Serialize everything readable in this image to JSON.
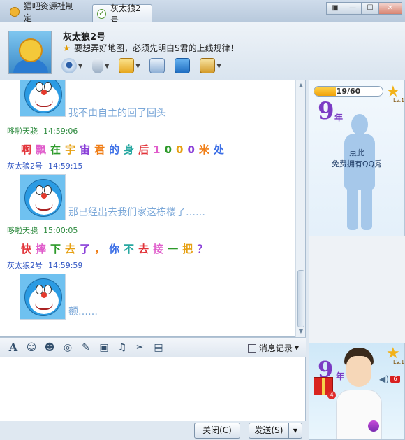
{
  "tabs": [
    {
      "label": "猫吧资源社制定",
      "icon": "user-icon"
    },
    {
      "label": "灰太狼2号",
      "icon": "online-check-icon"
    }
  ],
  "window_buttons": [
    "minimize",
    "restore",
    "close"
  ],
  "contact": {
    "nickname": "灰太狼2号",
    "signature": "要想弄好地图，必须先明白S君的上线规律！"
  },
  "messages": [
    {
      "type": "image",
      "text": "我不由自主的回了回头"
    },
    {
      "sender": "哆啦天骁",
      "time": "14:59:06"
    },
    {
      "type": "rainbow",
      "chars": [
        "啊",
        "飘",
        "在",
        "宇",
        "宙",
        "君",
        "的",
        "身",
        "后",
        "1",
        "0",
        "0",
        "0",
        "米",
        "处"
      ]
    },
    {
      "sender": "灰太狼2号",
      "time": "14:59:15"
    },
    {
      "type": "image",
      "text": "那已经出去我们家这栋楼了……"
    },
    {
      "sender": "哆啦天骁",
      "time": "15:00:05"
    },
    {
      "type": "rainbow",
      "chars": [
        "快",
        "摔",
        "下",
        "去",
        "了",
        "，",
        "你",
        "不",
        "去",
        "接",
        "一",
        "把",
        "？"
      ]
    },
    {
      "sender": "灰太狼2号",
      "time": "14:59:59"
    },
    {
      "type": "image",
      "text": "额……"
    }
  ],
  "input_toolbar": {
    "history_label": "消息记录"
  },
  "buttons": {
    "close": "关闭(C)",
    "send": "发送(S)"
  },
  "right_panel": {
    "xp": "19/60",
    "xp_fraction": 0.317,
    "level_label": "Lv.1",
    "years": "9",
    "year_unit": "年",
    "hint_line1": "点此",
    "hint_line2": "免费拥有QQ秀",
    "bottom_years": "9",
    "bottom_year_unit": "年",
    "gift_count": "4",
    "speaker_count": "6"
  }
}
